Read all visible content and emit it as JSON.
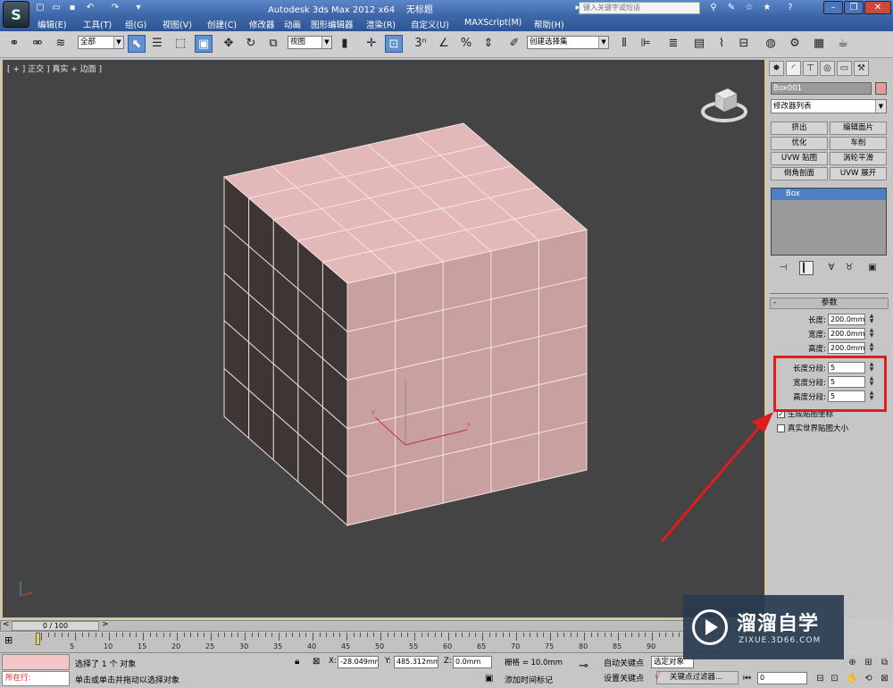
{
  "title": {
    "app_name": "Autodesk 3ds Max  2012 x64",
    "file_name": "无标题",
    "search_placeholder": "键入关键字或短语"
  },
  "menu": [
    "编辑(E)",
    "工具(T)",
    "组(G)",
    "视图(V)",
    "创建(C)",
    "修改器",
    "动画",
    "图形编辑器",
    "渲染(R)",
    "自定义(U)",
    "MAXScript(M)",
    "帮助(H)"
  ],
  "toolbar": {
    "selection_filter": "全部",
    "ref_coord": "视图",
    "named_selection": "创建选择集",
    "snap_label": "3"
  },
  "viewport": {
    "label": "[ + ] 正交 ] 真实 + 边面 ]",
    "axis_x": "x",
    "axis_y": "y",
    "axis_z": "z",
    "colors": {
      "face_top": "#e2b8b8",
      "face_front": "#c9a0a0",
      "face_side": "#3e3535",
      "background": "#444444"
    }
  },
  "command_panel": {
    "object_name": "Box001",
    "object_color": "#e39c9c",
    "modifier_list": "修改器列表",
    "modifier_buttons": [
      "挤出",
      "编辑面片",
      "优化",
      "车削",
      "UVW 贴图",
      "涡轮平滑",
      "倒角剖面",
      "UVW 展开"
    ],
    "stack_items": [
      "Box"
    ],
    "rollout_title": "参数",
    "params": [
      {
        "label": "长度:",
        "value": "200.0mm"
      },
      {
        "label": "宽度:",
        "value": "200.0mm"
      },
      {
        "label": "高度:",
        "value": "200.0mm"
      },
      {
        "label": "长度分段:",
        "value": "5"
      },
      {
        "label": "宽度分段:",
        "value": "5"
      },
      {
        "label": "高度分段:",
        "value": "5"
      }
    ],
    "checkboxes": [
      {
        "label": "生成贴图坐标",
        "checked": true
      },
      {
        "label": "真实世界贴图大小",
        "checked": false
      }
    ]
  },
  "timeline": {
    "frame_display": "0 / 100",
    "ticks": [
      "5",
      "10",
      "15",
      "20",
      "25",
      "30",
      "35",
      "40",
      "45",
      "50",
      "55",
      "60",
      "65",
      "70",
      "75",
      "80",
      "85",
      "90"
    ]
  },
  "status": {
    "script_label": "所在行:",
    "selection_info": "选择了 1 个 对象",
    "prompt": "单击或单击并拖动以选择对象",
    "x_label": "X:",
    "x_value": "-28.049mm",
    "y_label": "Y:",
    "y_value": "485.312mm",
    "z_label": "Z:",
    "z_value": "0.0mm",
    "grid": "栅格 = 10.0mm",
    "add_time_tag": "添加时间标记",
    "auto_key": "自动关键点",
    "set_key": "设置关键点",
    "selected_set": "选定对象",
    "key_filters": "关键点过滤器...",
    "current_frame": "0"
  },
  "watermark": {
    "title": "溜溜自学",
    "url": "ZIXUE.3D66.COM"
  },
  "annotation_color": "#e21c1c"
}
